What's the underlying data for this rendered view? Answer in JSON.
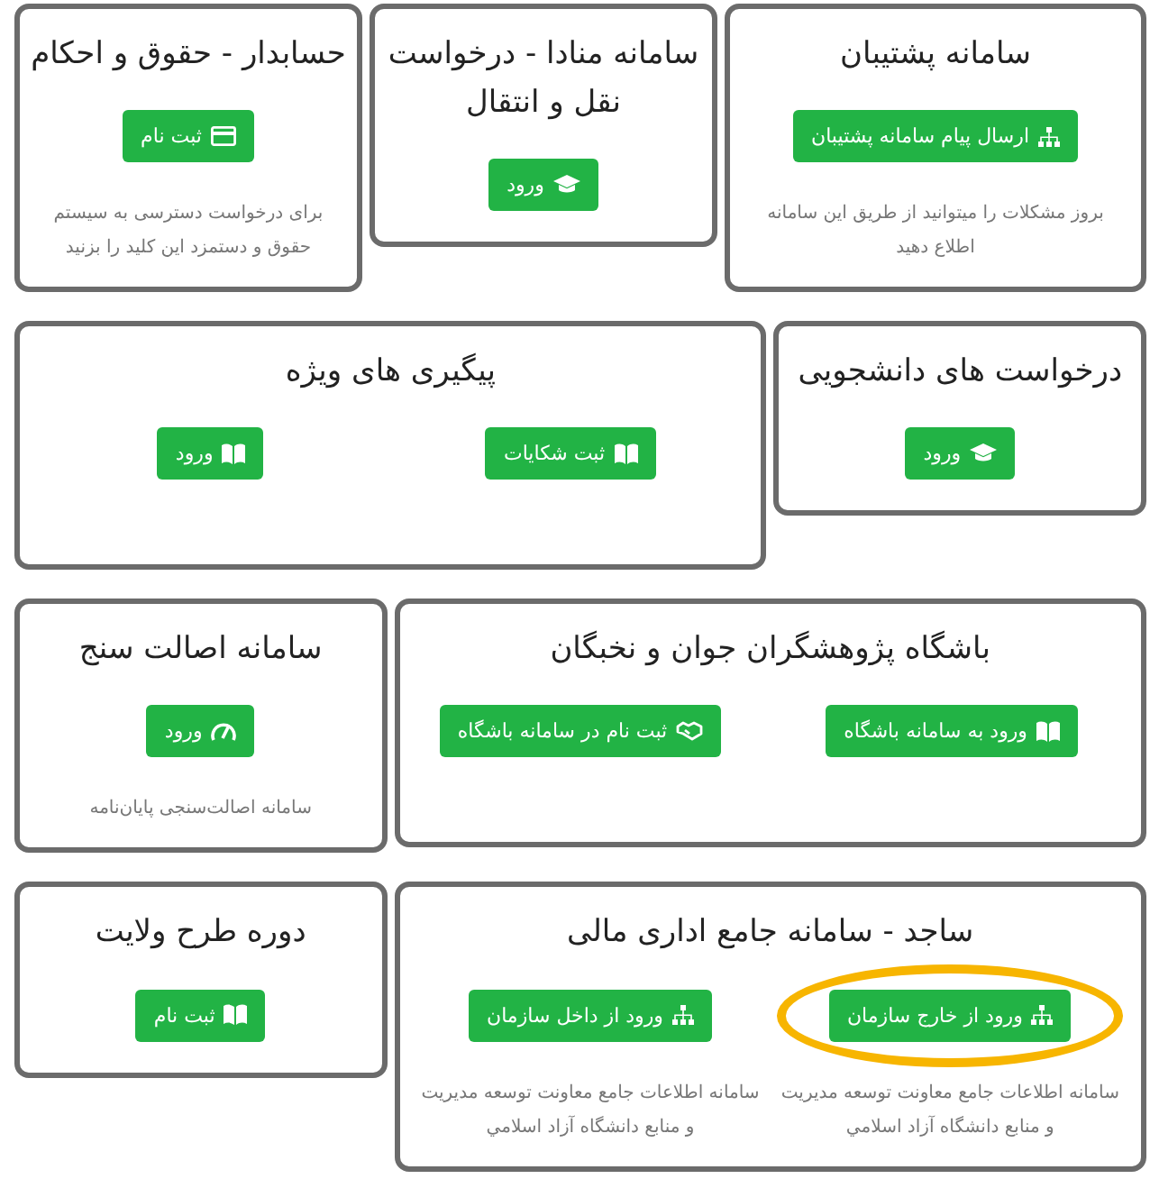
{
  "rows": [
    {
      "cards": [
        {
          "title": "سامانه پشتیبان",
          "columns": [
            {
              "button": {
                "label": "ارسال پیام سامانه پشتیبان",
                "kind": "sitemap",
                "highlighted": false
              },
              "note": "بروز مشکلات را میتوانید از طریق این سامانه اطلاع دهید"
            }
          ]
        },
        {
          "title": "سامانه منادا - درخواست نقل و انتقال",
          "columns": [
            {
              "button": {
                "label": "ورود",
                "kind": "graduation",
                "highlighted": false
              }
            }
          ]
        },
        {
          "title": "حسابدار - حقوق و احکام",
          "columns": [
            {
              "button": {
                "label": "ثبت نام",
                "kind": "card",
                "highlighted": false
              },
              "note": "برای درخواست دسترسی به سیستم حقوق و دستمزد این کلید را بزنید"
            }
          ]
        }
      ]
    },
    {
      "cards": [
        {
          "title": "درخواست های دانشجویی",
          "columns": [
            {
              "button": {
                "label": "ورود",
                "kind": "graduation",
                "highlighted": false
              }
            }
          ]
        },
        {
          "title": "پیگیری های ویژه",
          "columns": [
            {
              "button": {
                "label": "ثبت شکایات",
                "kind": "book",
                "highlighted": false
              }
            },
            {
              "button": {
                "label": "ورود",
                "kind": "book",
                "highlighted": false
              }
            }
          ]
        }
      ]
    },
    {
      "cards": [
        {
          "title": "باشگاه پژوهشگران جوان و نخبگان",
          "columns": [
            {
              "button": {
                "label": "ورود به سامانه باشگاه",
                "kind": "book",
                "highlighted": false
              }
            },
            {
              "button": {
                "label": "ثبت نام در سامانه باشگاه",
                "kind": "handshake",
                "highlighted": false
              }
            }
          ]
        },
        {
          "title": "سامانه اصالت سنج",
          "columns": [
            {
              "button": {
                "label": "ورود",
                "kind": "gauge",
                "highlighted": false
              },
              "note": "سامانه اصالت‌سنجی پایان‌نامه"
            }
          ]
        }
      ]
    },
    {
      "cards": [
        {
          "title": "ساجد - سامانه جامع اداری مالی",
          "columns": [
            {
              "button": {
                "label": "ورود از خارج سازمان",
                "kind": "sitemap",
                "highlighted": true
              },
              "note": "سامانه اطلاعات جامع معاونت توسعه مدیریت و منابع دانشگاه آزاد اسلامي"
            },
            {
              "button": {
                "label": "ورود از داخل سازمان",
                "kind": "sitemap",
                "highlighted": false
              },
              "note": "سامانه اطلاعات جامع معاونت توسعه مدیریت و منابع دانشگاه آزاد اسلامي"
            }
          ]
        },
        {
          "title": "دوره طرح ولایت",
          "columns": [
            {
              "button": {
                "label": "ثبت نام",
                "kind": "book",
                "highlighted": false
              }
            }
          ]
        }
      ]
    }
  ]
}
